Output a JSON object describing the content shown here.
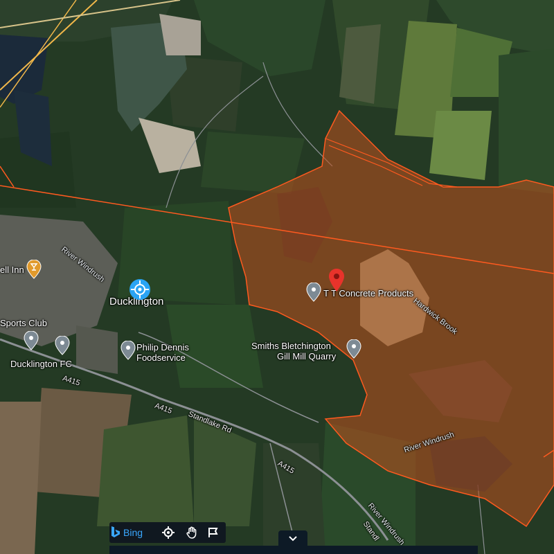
{
  "map": {
    "place_labels": {
      "ducklington": "Ducklington",
      "tt_concrete": "T T Concrete Products",
      "smiths_line1": "Smiths Bletchington",
      "smiths_line2": "Gill Mill Quarry",
      "philip_line1": "Philip Dennis",
      "philip_line2": "Foodservice",
      "sports_club": "Sports Club",
      "ducklington_fc": "Ducklington FC",
      "inn": "ell Inn"
    },
    "road_labels": {
      "a415_1": "A415",
      "a415_2": "A415",
      "a415_3": "A415",
      "standlake_rd": "Standlake Rd",
      "standl": "Standl"
    },
    "water_labels": {
      "river_windrush_1": "River Windrush",
      "river_windrush_2": "River Windrush",
      "river_windrush_3": "River Windrush",
      "hardwick_brook": "Hardwick Brook"
    },
    "colors": {
      "boundary": "#ff5a1f",
      "overlay_fill": "#c0501e",
      "selected_pin": "#e8332b",
      "location_marker": "#2aa4f4",
      "grey_pin": "#7d8a94",
      "orange_pin": "#e19a2c"
    }
  },
  "toolbar": {
    "bing_label": "Bing",
    "icons": [
      "bing-logo-icon",
      "locate-icon",
      "pan-hand-icon",
      "select-area-icon",
      "chevron-down-icon"
    ]
  }
}
